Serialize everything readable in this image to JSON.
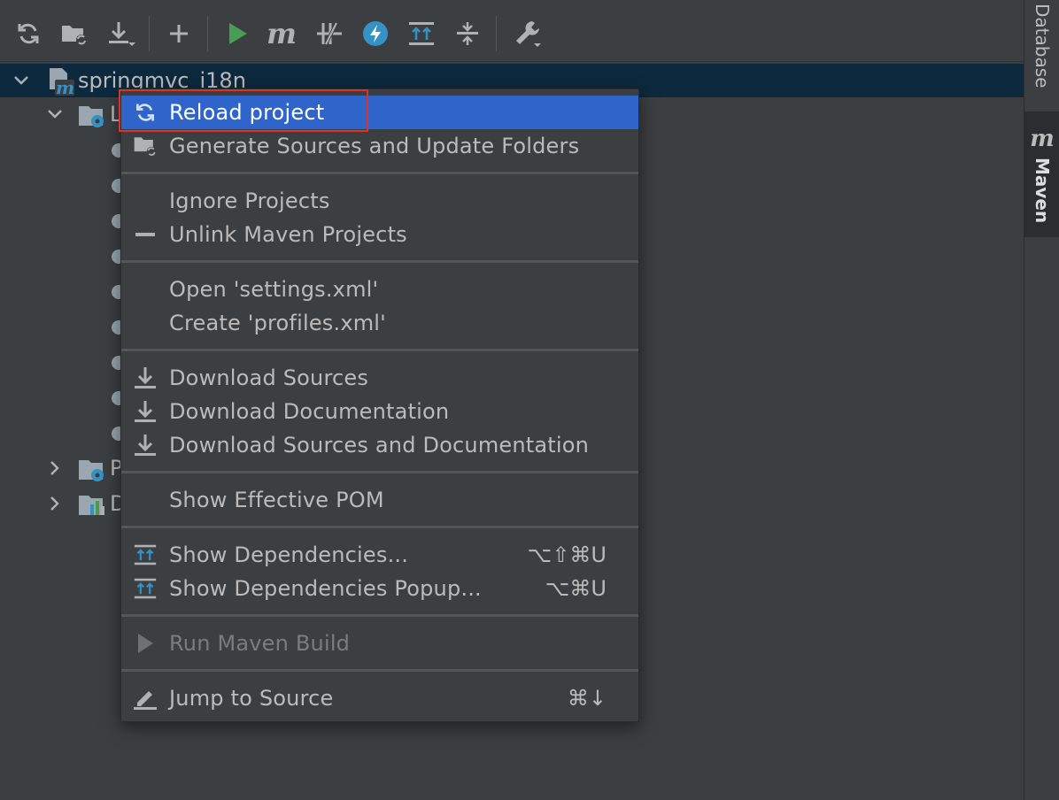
{
  "toolbar": {
    "buttons": [
      {
        "name": "reload-all-icon"
      },
      {
        "name": "generate-sources-icon"
      },
      {
        "name": "download-icon"
      },
      {
        "name": "add-icon"
      },
      {
        "name": "run-icon"
      },
      {
        "name": "execute-goal-icon"
      },
      {
        "name": "toggle-offline-icon"
      },
      {
        "name": "skip-tests-icon"
      },
      {
        "name": "show-dependencies-icon"
      },
      {
        "name": "collapse-all-icon"
      },
      {
        "name": "settings-wrench-icon"
      }
    ],
    "run_color": "#499c54",
    "skip_tests_color": "#3592c4"
  },
  "tree": {
    "project_name": "springmvc_i18n",
    "lifecycle_label_partial": "L",
    "plugins_label_partial": "P",
    "dependencies_label_partial": "D",
    "selected_row_color": "#0d293e"
  },
  "right_strip": {
    "database_label": "Database",
    "maven_label": "Maven",
    "maven_glyph": "m"
  },
  "context_menu": {
    "highlight_color": "#2f65ca",
    "outline_color": "#d9342b",
    "items": [
      {
        "label": "Reload project",
        "icon": "reload-icon",
        "shortcut": ""
      },
      {
        "label": "Generate Sources and Update Folders",
        "icon": "generate-sources-folder-icon",
        "shortcut": ""
      },
      {
        "label": "Ignore Projects",
        "icon": "",
        "shortcut": ""
      },
      {
        "label": "Unlink Maven Projects",
        "icon": "minus-icon",
        "shortcut": ""
      },
      {
        "label": "Open 'settings.xml'",
        "icon": "",
        "shortcut": ""
      },
      {
        "label": "Create 'profiles.xml'",
        "icon": "",
        "shortcut": ""
      },
      {
        "label": "Download Sources",
        "icon": "download-icon",
        "shortcut": ""
      },
      {
        "label": "Download Documentation",
        "icon": "download-icon",
        "shortcut": ""
      },
      {
        "label": "Download Sources and Documentation",
        "icon": "download-icon",
        "shortcut": ""
      },
      {
        "label": "Show Effective POM",
        "icon": "",
        "shortcut": ""
      },
      {
        "label": "Show Dependencies...",
        "icon": "dependencies-icon",
        "shortcut": "⌥⇧⌘U"
      },
      {
        "label": "Show Dependencies Popup...",
        "icon": "dependencies-icon",
        "shortcut": "⌥⌘U"
      },
      {
        "label": "Run Maven Build",
        "icon": "run-disabled-icon",
        "shortcut": ""
      },
      {
        "label": "Jump to Source",
        "icon": "edit-pencil-icon",
        "shortcut": "⌘↓"
      }
    ]
  }
}
